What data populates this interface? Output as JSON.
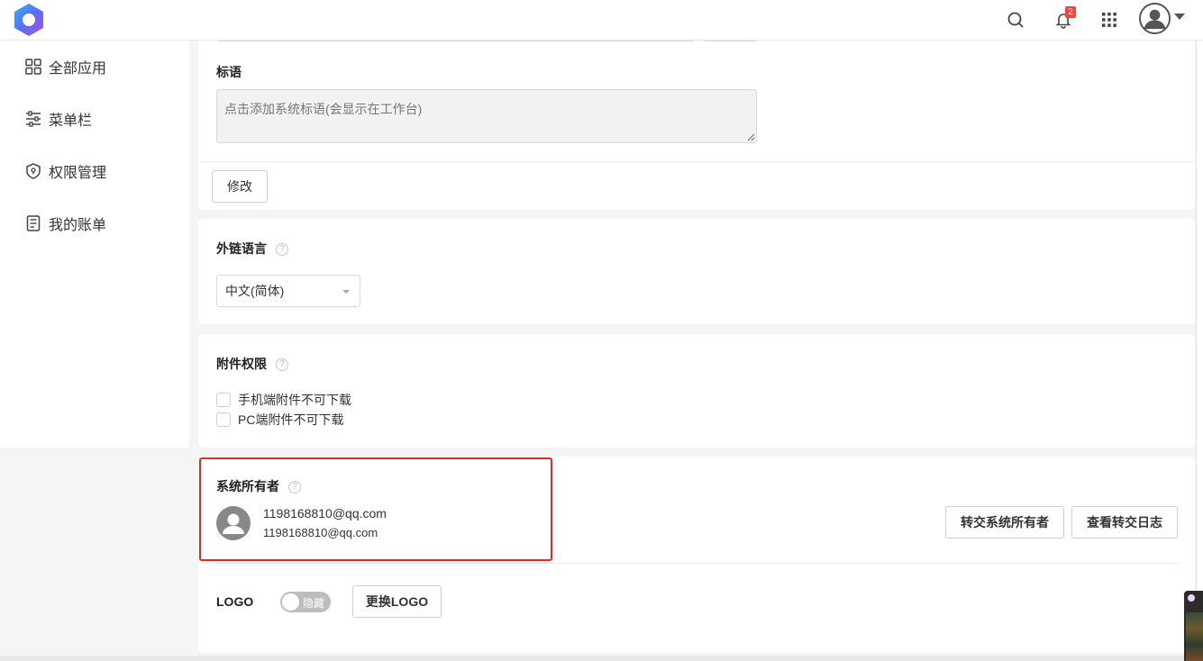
{
  "header": {
    "notification_count": "2",
    "icons": [
      "app-logo",
      "search-icon",
      "bell-icon",
      "apps-grid-icon",
      "user-avatar-icon",
      "caret-down-icon"
    ]
  },
  "sidebar": {
    "items": [
      {
        "label": "全部应用",
        "icon": "grid-icon"
      },
      {
        "label": "菜单栏",
        "icon": "sliders-icon"
      },
      {
        "label": "权限管理",
        "icon": "shield-icon"
      },
      {
        "label": "我的账单",
        "icon": "bill-icon"
      }
    ]
  },
  "slogan": {
    "label": "标语",
    "placeholder": "点击添加系统标语(会显示在工作台)",
    "modify_button": "修改"
  },
  "language": {
    "label": "外链语言",
    "help": "?",
    "selected": "中文(简体)"
  },
  "attachments": {
    "label": "附件权限",
    "help": "?",
    "options": [
      "手机端附件不可下载",
      "PC端附件不可下载"
    ]
  },
  "owner": {
    "label": "系统所有者",
    "help": "?",
    "name": "1198168810@qq.com",
    "email": "1198168810@qq.com",
    "transfer_button": "转交系统所有者",
    "log_button": "查看转交日志"
  },
  "logo": {
    "label": "LOGO",
    "toggle_text": "隐藏",
    "toggle_on": false,
    "replace_button": "更换LOGO"
  },
  "colors": {
    "highlight_border": "#e02a2a",
    "badge": "#f5433d"
  }
}
